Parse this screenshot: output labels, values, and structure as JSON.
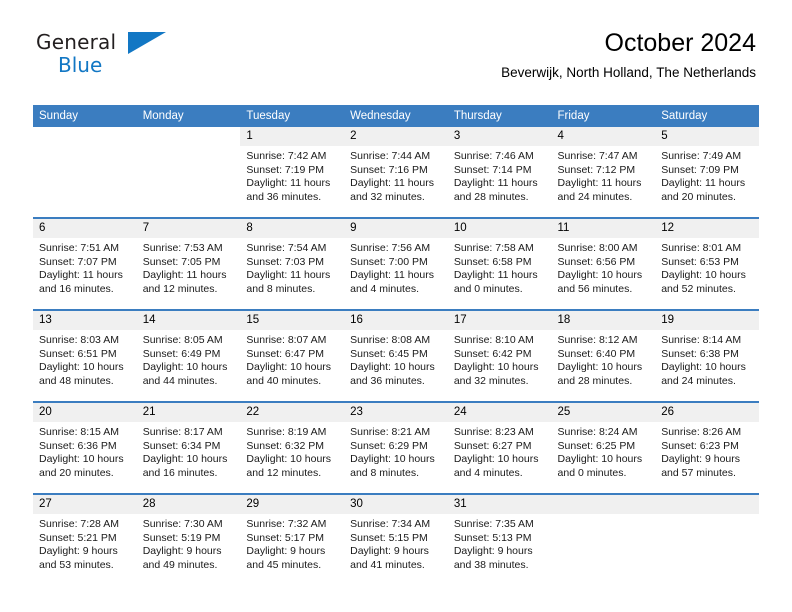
{
  "brand": {
    "name_top": "General",
    "name_bottom": "Blue",
    "color_blue": "#1277c4",
    "color_dark": "#231f20",
    "triangle_icon": "triangle-icon"
  },
  "header": {
    "title": "October 2024",
    "subtitle": "Beverwijk, North Holland, The Netherlands"
  },
  "theme": {
    "header_row_bg": "#3b7dc0",
    "daynum_bg": "#f0f0f0",
    "grid_line": "#3b7dc0"
  },
  "weekdays": [
    "Sunday",
    "Monday",
    "Tuesday",
    "Wednesday",
    "Thursday",
    "Friday",
    "Saturday"
  ],
  "weeks": [
    [
      {
        "blank": true
      },
      {
        "blank": true
      },
      {
        "day": "1",
        "sunrise": "Sunrise: 7:42 AM",
        "sunset": "Sunset: 7:19 PM",
        "daylight1": "Daylight: 11 hours",
        "daylight2": "and 36 minutes."
      },
      {
        "day": "2",
        "sunrise": "Sunrise: 7:44 AM",
        "sunset": "Sunset: 7:16 PM",
        "daylight1": "Daylight: 11 hours",
        "daylight2": "and 32 minutes."
      },
      {
        "day": "3",
        "sunrise": "Sunrise: 7:46 AM",
        "sunset": "Sunset: 7:14 PM",
        "daylight1": "Daylight: 11 hours",
        "daylight2": "and 28 minutes."
      },
      {
        "day": "4",
        "sunrise": "Sunrise: 7:47 AM",
        "sunset": "Sunset: 7:12 PM",
        "daylight1": "Daylight: 11 hours",
        "daylight2": "and 24 minutes."
      },
      {
        "day": "5",
        "sunrise": "Sunrise: 7:49 AM",
        "sunset": "Sunset: 7:09 PM",
        "daylight1": "Daylight: 11 hours",
        "daylight2": "and 20 minutes."
      }
    ],
    [
      {
        "day": "6",
        "sunrise": "Sunrise: 7:51 AM",
        "sunset": "Sunset: 7:07 PM",
        "daylight1": "Daylight: 11 hours",
        "daylight2": "and 16 minutes."
      },
      {
        "day": "7",
        "sunrise": "Sunrise: 7:53 AM",
        "sunset": "Sunset: 7:05 PM",
        "daylight1": "Daylight: 11 hours",
        "daylight2": "and 12 minutes."
      },
      {
        "day": "8",
        "sunrise": "Sunrise: 7:54 AM",
        "sunset": "Sunset: 7:03 PM",
        "daylight1": "Daylight: 11 hours",
        "daylight2": "and 8 minutes."
      },
      {
        "day": "9",
        "sunrise": "Sunrise: 7:56 AM",
        "sunset": "Sunset: 7:00 PM",
        "daylight1": "Daylight: 11 hours",
        "daylight2": "and 4 minutes."
      },
      {
        "day": "10",
        "sunrise": "Sunrise: 7:58 AM",
        "sunset": "Sunset: 6:58 PM",
        "daylight1": "Daylight: 11 hours",
        "daylight2": "and 0 minutes."
      },
      {
        "day": "11",
        "sunrise": "Sunrise: 8:00 AM",
        "sunset": "Sunset: 6:56 PM",
        "daylight1": "Daylight: 10 hours",
        "daylight2": "and 56 minutes."
      },
      {
        "day": "12",
        "sunrise": "Sunrise: 8:01 AM",
        "sunset": "Sunset: 6:53 PM",
        "daylight1": "Daylight: 10 hours",
        "daylight2": "and 52 minutes."
      }
    ],
    [
      {
        "day": "13",
        "sunrise": "Sunrise: 8:03 AM",
        "sunset": "Sunset: 6:51 PM",
        "daylight1": "Daylight: 10 hours",
        "daylight2": "and 48 minutes."
      },
      {
        "day": "14",
        "sunrise": "Sunrise: 8:05 AM",
        "sunset": "Sunset: 6:49 PM",
        "daylight1": "Daylight: 10 hours",
        "daylight2": "and 44 minutes."
      },
      {
        "day": "15",
        "sunrise": "Sunrise: 8:07 AM",
        "sunset": "Sunset: 6:47 PM",
        "daylight1": "Daylight: 10 hours",
        "daylight2": "and 40 minutes."
      },
      {
        "day": "16",
        "sunrise": "Sunrise: 8:08 AM",
        "sunset": "Sunset: 6:45 PM",
        "daylight1": "Daylight: 10 hours",
        "daylight2": "and 36 minutes."
      },
      {
        "day": "17",
        "sunrise": "Sunrise: 8:10 AM",
        "sunset": "Sunset: 6:42 PM",
        "daylight1": "Daylight: 10 hours",
        "daylight2": "and 32 minutes."
      },
      {
        "day": "18",
        "sunrise": "Sunrise: 8:12 AM",
        "sunset": "Sunset: 6:40 PM",
        "daylight1": "Daylight: 10 hours",
        "daylight2": "and 28 minutes."
      },
      {
        "day": "19",
        "sunrise": "Sunrise: 8:14 AM",
        "sunset": "Sunset: 6:38 PM",
        "daylight1": "Daylight: 10 hours",
        "daylight2": "and 24 minutes."
      }
    ],
    [
      {
        "day": "20",
        "sunrise": "Sunrise: 8:15 AM",
        "sunset": "Sunset: 6:36 PM",
        "daylight1": "Daylight: 10 hours",
        "daylight2": "and 20 minutes."
      },
      {
        "day": "21",
        "sunrise": "Sunrise: 8:17 AM",
        "sunset": "Sunset: 6:34 PM",
        "daylight1": "Daylight: 10 hours",
        "daylight2": "and 16 minutes."
      },
      {
        "day": "22",
        "sunrise": "Sunrise: 8:19 AM",
        "sunset": "Sunset: 6:32 PM",
        "daylight1": "Daylight: 10 hours",
        "daylight2": "and 12 minutes."
      },
      {
        "day": "23",
        "sunrise": "Sunrise: 8:21 AM",
        "sunset": "Sunset: 6:29 PM",
        "daylight1": "Daylight: 10 hours",
        "daylight2": "and 8 minutes."
      },
      {
        "day": "24",
        "sunrise": "Sunrise: 8:23 AM",
        "sunset": "Sunset: 6:27 PM",
        "daylight1": "Daylight: 10 hours",
        "daylight2": "and 4 minutes."
      },
      {
        "day": "25",
        "sunrise": "Sunrise: 8:24 AM",
        "sunset": "Sunset: 6:25 PM",
        "daylight1": "Daylight: 10 hours",
        "daylight2": "and 0 minutes."
      },
      {
        "day": "26",
        "sunrise": "Sunrise: 8:26 AM",
        "sunset": "Sunset: 6:23 PM",
        "daylight1": "Daylight: 9 hours",
        "daylight2": "and 57 minutes."
      }
    ],
    [
      {
        "day": "27",
        "sunrise": "Sunrise: 7:28 AM",
        "sunset": "Sunset: 5:21 PM",
        "daylight1": "Daylight: 9 hours",
        "daylight2": "and 53 minutes."
      },
      {
        "day": "28",
        "sunrise": "Sunrise: 7:30 AM",
        "sunset": "Sunset: 5:19 PM",
        "daylight1": "Daylight: 9 hours",
        "daylight2": "and 49 minutes."
      },
      {
        "day": "29",
        "sunrise": "Sunrise: 7:32 AM",
        "sunset": "Sunset: 5:17 PM",
        "daylight1": "Daylight: 9 hours",
        "daylight2": "and 45 minutes."
      },
      {
        "day": "30",
        "sunrise": "Sunrise: 7:34 AM",
        "sunset": "Sunset: 5:15 PM",
        "daylight1": "Daylight: 9 hours",
        "daylight2": "and 41 minutes."
      },
      {
        "day": "31",
        "sunrise": "Sunrise: 7:35 AM",
        "sunset": "Sunset: 5:13 PM",
        "daylight1": "Daylight: 9 hours",
        "daylight2": "and 38 minutes."
      },
      {
        "empty": true
      },
      {
        "empty": true
      }
    ]
  ]
}
